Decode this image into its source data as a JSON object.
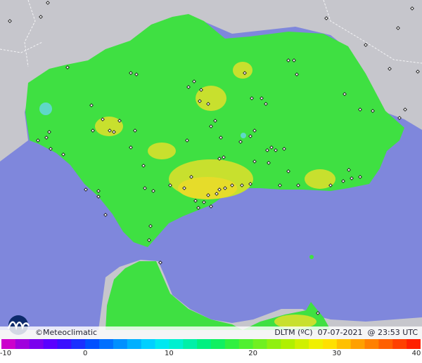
{
  "brand": {
    "name": "Meteoclimatic",
    "copyright": "©"
  },
  "layer": {
    "variable": "DLTM (ºC)",
    "date": "07-07-2021",
    "time": "@ 23:53 UTC"
  },
  "colors": {
    "sea": "#7f87dc",
    "land_outside": "#c6c6cc",
    "border_line": "#f4f4f6",
    "base_land": "#3fe042",
    "warm_zone": "#c8e02e",
    "hot_zone": "#e6dc2a",
    "cold_spot": "#5fd8c8",
    "station": "#1a1a1a"
  },
  "scale": {
    "min": -10,
    "max": 40,
    "tick_labels": [
      "-10",
      "0",
      "10",
      "20",
      "30",
      "40"
    ],
    "swatches": [
      "#cc00cc",
      "#a000dd",
      "#7a00ee",
      "#5a00ff",
      "#3a10ff",
      "#1a30ff",
      "#0050ff",
      "#0070ff",
      "#0090ff",
      "#00b0ff",
      "#00d0ff",
      "#00e8f0",
      "#00f0d0",
      "#00f0a8",
      "#00f080",
      "#10f060",
      "#30f040",
      "#50f030",
      "#70f020",
      "#90f010",
      "#b0f000",
      "#d0f000",
      "#f0f000",
      "#ffe000",
      "#ffc000",
      "#ffa000",
      "#ff8000",
      "#ff6000",
      "#ff4000",
      "#ff2000"
    ]
  }
}
